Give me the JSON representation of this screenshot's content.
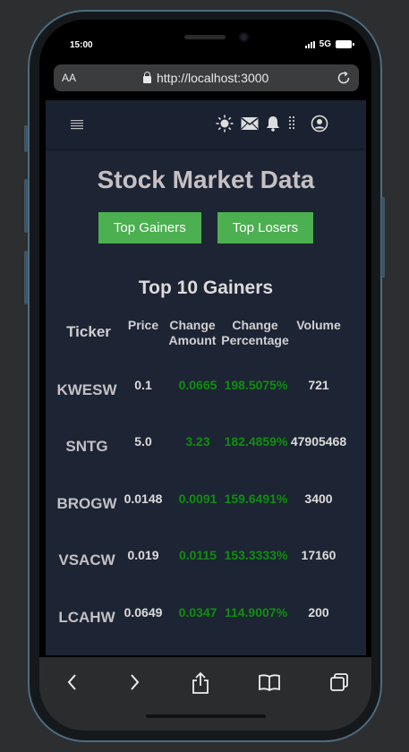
{
  "status": {
    "time": "15:00",
    "network": "5G"
  },
  "browser": {
    "text_size_label": "AA",
    "url": "http://localhost:3000"
  },
  "nav": {
    "icons": [
      "menu-icon",
      "sun-icon",
      "mail-icon",
      "bell-icon",
      "kebab-icon",
      "user-icon"
    ]
  },
  "page": {
    "title": "Stock Market Data",
    "buttons": {
      "gainers": "Top Gainers",
      "losers": "Top Losers"
    },
    "section_title": "Top 10 Gainers"
  },
  "table": {
    "headers": {
      "ticker": "Ticker",
      "price": "Price",
      "change_amount_1": "Change",
      "change_amount_2": "Amount",
      "change_pct_1": "Change",
      "change_pct_2": "Percentage",
      "volume": "Volume"
    },
    "rows": [
      {
        "ticker": "KWESW",
        "price": "0.1",
        "change_amount": "0.0665",
        "change_percentage": "198.5075%",
        "volume": "721"
      },
      {
        "ticker": "SNTG",
        "price": "5.0",
        "change_amount": "3.23",
        "change_percentage": "182.4859%",
        "volume": "47905468"
      },
      {
        "ticker": "BROGW",
        "price": "0.0148",
        "change_amount": "0.0091",
        "change_percentage": "159.6491%",
        "volume": "3400"
      },
      {
        "ticker": "VSACW",
        "price": "0.019",
        "change_amount": "0.0115",
        "change_percentage": "153.3333%",
        "volume": "17160"
      },
      {
        "ticker": "LCAHW",
        "price": "0.0649",
        "change_amount": "0.0347",
        "change_percentage": "114.9007%",
        "volume": "200"
      }
    ]
  },
  "colors": {
    "background": "#1d2433",
    "button": "#4caf50",
    "positive": "#0f8e10"
  },
  "toolbar": {
    "icons": [
      "back-icon",
      "forward-icon",
      "share-icon",
      "bookmarks-icon",
      "tabs-icon"
    ]
  }
}
